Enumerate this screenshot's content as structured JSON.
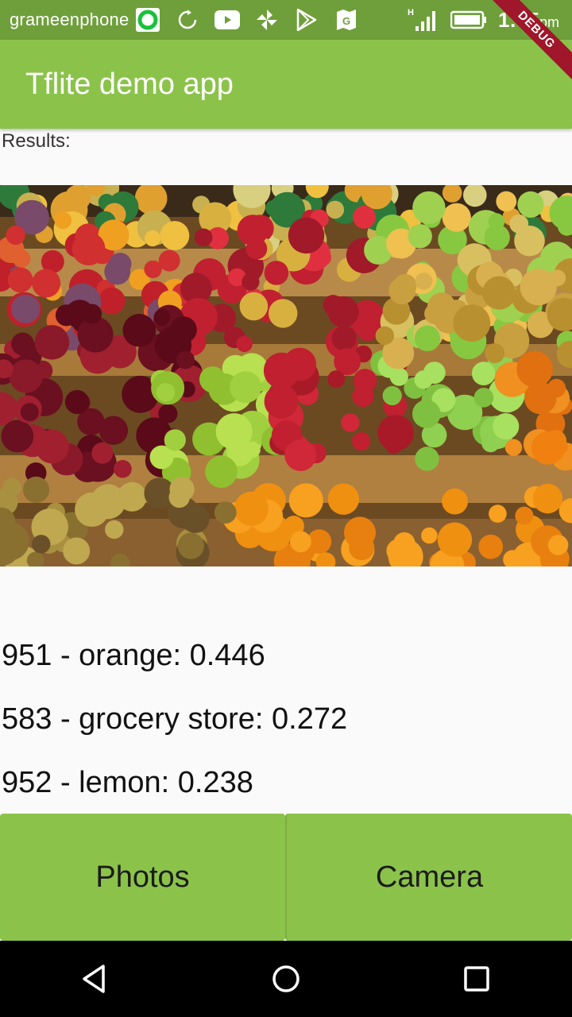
{
  "status_bar": {
    "carrier": "grameenphone",
    "time": "1:05",
    "time_suffix": "pm",
    "network_type": "H",
    "icons": [
      "grameenphone-app-icon",
      "sync-icon",
      "youtube-icon",
      "pinwheel-icon",
      "play-store-icon",
      "maps-icon",
      "signal-icon",
      "battery-icon"
    ]
  },
  "debug_banner": "DEBUG",
  "app_bar": {
    "title": "Tflite demo app"
  },
  "results": {
    "label": "Results:",
    "items": [
      "951 - orange: 0.446",
      "583 - grocery store: 0.272",
      "952 - lemon: 0.238"
    ]
  },
  "buttons": {
    "photos": "Photos",
    "camera": "Camera"
  },
  "nav": [
    "back-icon",
    "home-icon",
    "recents-icon"
  ],
  "colors": {
    "status_bar": "#6f9f3a",
    "app_bar": "#8bc34a",
    "button": "#8bc34a",
    "debug": "#a0162a",
    "nav_bar": "#000000"
  }
}
